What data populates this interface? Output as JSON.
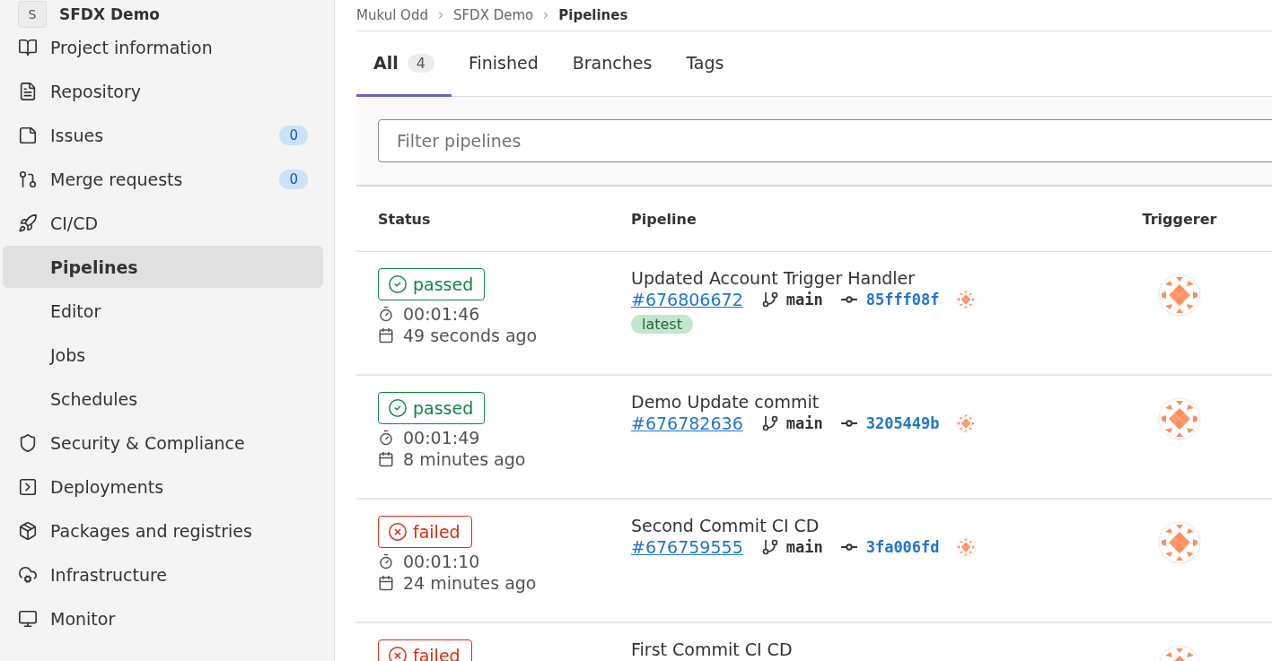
{
  "project": {
    "initial": "S",
    "name": "SFDX Demo"
  },
  "breadcrumb": [
    "Mukul Odd",
    "SFDX Demo",
    "Pipelines"
  ],
  "sidebar": {
    "items": [
      {
        "label": "Project information",
        "selected": false
      },
      {
        "label": "Repository",
        "selected": false
      },
      {
        "label": "Issues",
        "badge": "0",
        "selected": false
      },
      {
        "label": "Merge requests",
        "badge": "0",
        "selected": false
      },
      {
        "label": "CI/CD",
        "selected": false,
        "children": [
          {
            "label": "Pipelines",
            "selected": true
          },
          {
            "label": "Editor",
            "selected": false
          },
          {
            "label": "Jobs",
            "selected": false
          },
          {
            "label": "Schedules",
            "selected": false
          }
        ]
      },
      {
        "label": "Security & Compliance",
        "selected": false
      },
      {
        "label": "Deployments",
        "selected": false
      },
      {
        "label": "Packages and registries",
        "selected": false
      },
      {
        "label": "Infrastructure",
        "selected": false
      },
      {
        "label": "Monitor",
        "selected": false
      }
    ]
  },
  "tabs": [
    {
      "label": "All",
      "count": "4",
      "selected": true
    },
    {
      "label": "Finished",
      "selected": false
    },
    {
      "label": "Branches",
      "selected": false
    },
    {
      "label": "Tags",
      "selected": false
    }
  ],
  "filter": {
    "placeholder": "Filter pipelines"
  },
  "table": {
    "columns": [
      "Status",
      "Pipeline",
      "Triggerer"
    ],
    "rows": [
      {
        "status": {
          "kind": "passed",
          "label": "passed"
        },
        "duration": "00:01:46",
        "finished": "49 seconds ago",
        "title": "Updated Account Trigger Handler",
        "id": "#676806672",
        "branch": "main",
        "commit": "85fff08f",
        "badges": [
          "latest"
        ]
      },
      {
        "status": {
          "kind": "passed",
          "label": "passed"
        },
        "duration": "00:01:49",
        "finished": "8 minutes ago",
        "title": "Demo Update commit",
        "id": "#676782636",
        "branch": "main",
        "commit": "3205449b"
      },
      {
        "status": {
          "kind": "failed",
          "label": "failed"
        },
        "duration": "00:01:10",
        "finished": "24 minutes ago",
        "title": "Second Commit CI CD",
        "id": "#676759555",
        "branch": "main",
        "commit": "3fa006fd"
      },
      {
        "status": {
          "kind": "failed",
          "label": "failed"
        },
        "title": "First Commit CI CD"
      }
    ]
  }
}
